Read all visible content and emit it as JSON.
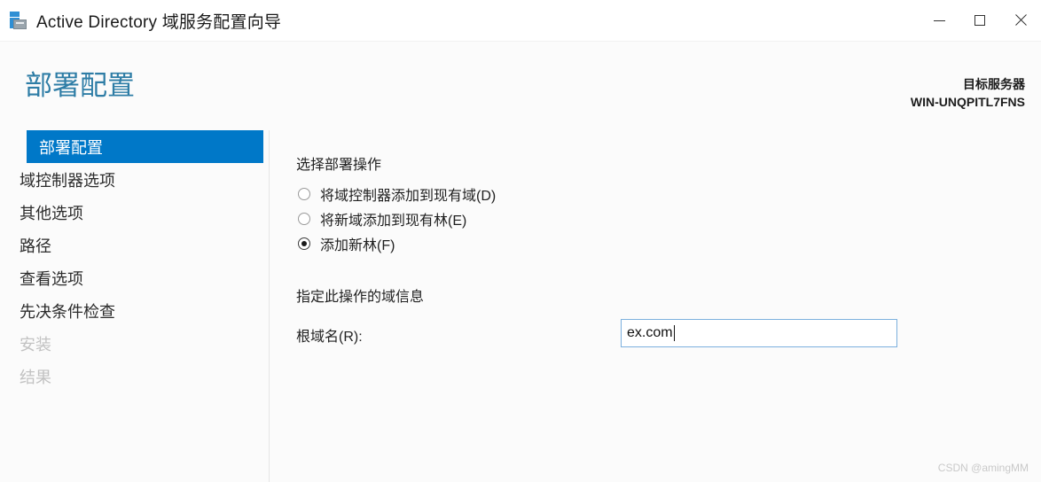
{
  "window": {
    "title": "Active Directory 域服务配置向导",
    "icon": "server-icon",
    "controls": {
      "minimize": "minimize-icon",
      "maximize": "maximize-icon",
      "close": "close-icon"
    }
  },
  "header": {
    "page_title": "部署配置",
    "target_server_label": "目标服务器",
    "target_server_name": "WIN-UNQPITL7FNS"
  },
  "sidebar": {
    "items": [
      {
        "label": "部署配置",
        "state": "selected"
      },
      {
        "label": "域控制器选项",
        "state": "enabled"
      },
      {
        "label": "其他选项",
        "state": "enabled"
      },
      {
        "label": "路径",
        "state": "enabled"
      },
      {
        "label": "查看选项",
        "state": "enabled"
      },
      {
        "label": "先决条件检查",
        "state": "enabled"
      },
      {
        "label": "安装",
        "state": "disabled"
      },
      {
        "label": "结果",
        "state": "disabled"
      }
    ]
  },
  "main": {
    "operation_section_label": "选择部署操作",
    "radio_options": [
      {
        "label": "将域控制器添加到现有域(D)",
        "checked": false
      },
      {
        "label": "将新域添加到现有林(E)",
        "checked": false
      },
      {
        "label": "添加新林(F)",
        "checked": true
      }
    ],
    "domain_info_label": "指定此操作的域信息",
    "root_domain_label": "根域名(R):",
    "root_domain_value": "ex.com"
  },
  "watermark": "CSDN @amingMM",
  "colors": {
    "accent_selected": "#0078c8",
    "page_title": "#2e7da6",
    "input_focus_border": "#7cb0de",
    "disabled_text": "#c2c2c2"
  }
}
